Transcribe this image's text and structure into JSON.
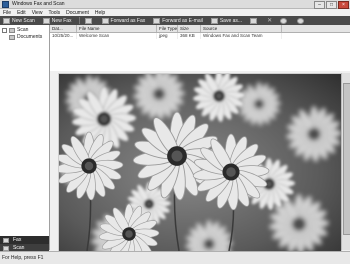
{
  "window": {
    "title": "Windows Fax and Scan"
  },
  "menu": [
    "File",
    "Edit",
    "View",
    "Tools",
    "Document",
    "Help"
  ],
  "toolbar": {
    "new_scan": "New Scan",
    "new_fax": "New Fax",
    "forward_fax": "Forward as Fax",
    "forward_email": "Forward as E-mail",
    "save_as": "Save as..."
  },
  "sidebar": {
    "root": "Scan",
    "child": "Documents",
    "tab_fax": "Fax",
    "tab_scan": "Scan"
  },
  "list": {
    "headers": [
      "Dat...",
      "File Name",
      "File Type",
      "Size",
      "Source"
    ],
    "rows": [
      [
        "10/25/20...",
        "Welcome Scan",
        "jpeg",
        "368 KB",
        "Windows Fax and Scan Team"
      ]
    ]
  },
  "preview": {
    "image": "daisy-flowers-photo"
  },
  "status": {
    "text": "For Help, press F1"
  }
}
